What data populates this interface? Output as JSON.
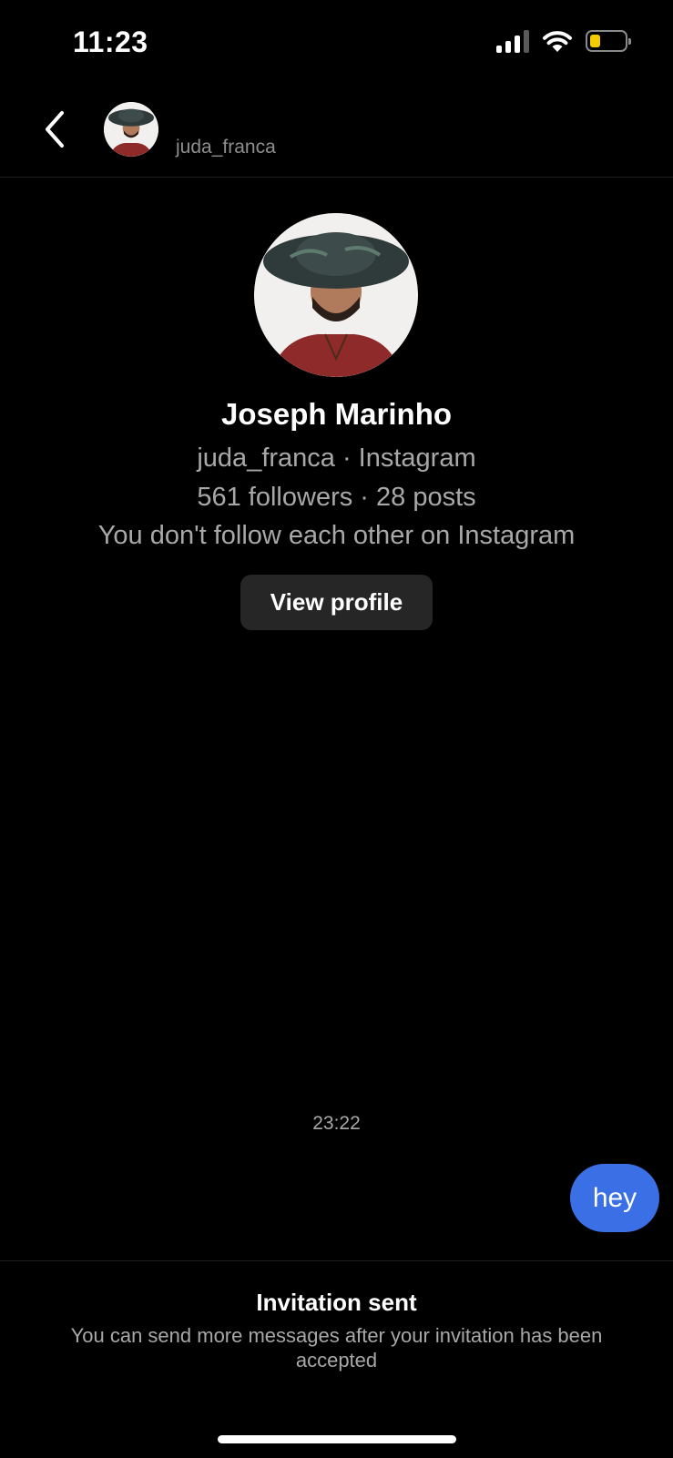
{
  "status_bar": {
    "time": "11:23",
    "icons": [
      "cellular-signal-icon",
      "wifi-icon",
      "battery-icon"
    ],
    "battery_level": 0.3,
    "battery_color": "#f5cc00"
  },
  "header": {
    "back_icon": "chevron-left-icon",
    "avatar_icon": "profile-photo",
    "username": "juda_franca"
  },
  "profile": {
    "avatar_icon": "profile-photo",
    "name": "Joseph Marinho",
    "handle_line": "juda_franca · Instagram",
    "stats_line": "561 followers · 28 posts",
    "follow_status": "You don't follow each other on Instagram",
    "view_profile_label": "View profile"
  },
  "conversation": {
    "timestamp": "23:22",
    "messages": [
      {
        "direction": "outgoing",
        "text": "hey"
      }
    ],
    "bubble_color": "#3b6fe6"
  },
  "footer": {
    "title": "Invitation sent",
    "body": "You can send more messages after your invitation has been accepted"
  }
}
